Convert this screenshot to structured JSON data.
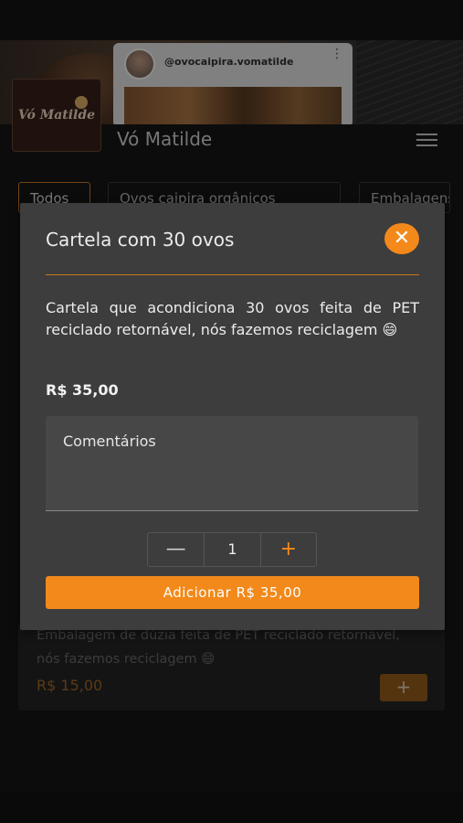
{
  "cover": {
    "instagram_handle": "@ovocaipira.vomatilde"
  },
  "header": {
    "logo_text": "Vó Matilde",
    "store_name": "Vó Matilde"
  },
  "tabs": [
    {
      "label": "Todos",
      "active": true
    },
    {
      "label": "Ovos caipira orgânicos",
      "active": false
    },
    {
      "label": "Embalagens",
      "active": false
    }
  ],
  "background_product": {
    "description": "Embalagem de dúzia feita de PET reciclado retornável, nós fazemos reciclagem 😄",
    "price": "R$ 15,00",
    "add_label": "+"
  },
  "modal": {
    "title": "Cartela com 30 ovos",
    "close_label": "✕",
    "description": "Cartela que acondiciona 30 ovos feita de PET reciclado retornável, nós fazemos reciclagem 😄",
    "price": "R$ 35,00",
    "comments_placeholder": "Comentários",
    "quantity": "1",
    "minus_label": "—",
    "plus_label": "+",
    "add_button_label": "Adicionar R$ 35,00"
  },
  "colors": {
    "accent": "#f2891a",
    "background": "#161616",
    "modal": "#3d3d3d"
  }
}
